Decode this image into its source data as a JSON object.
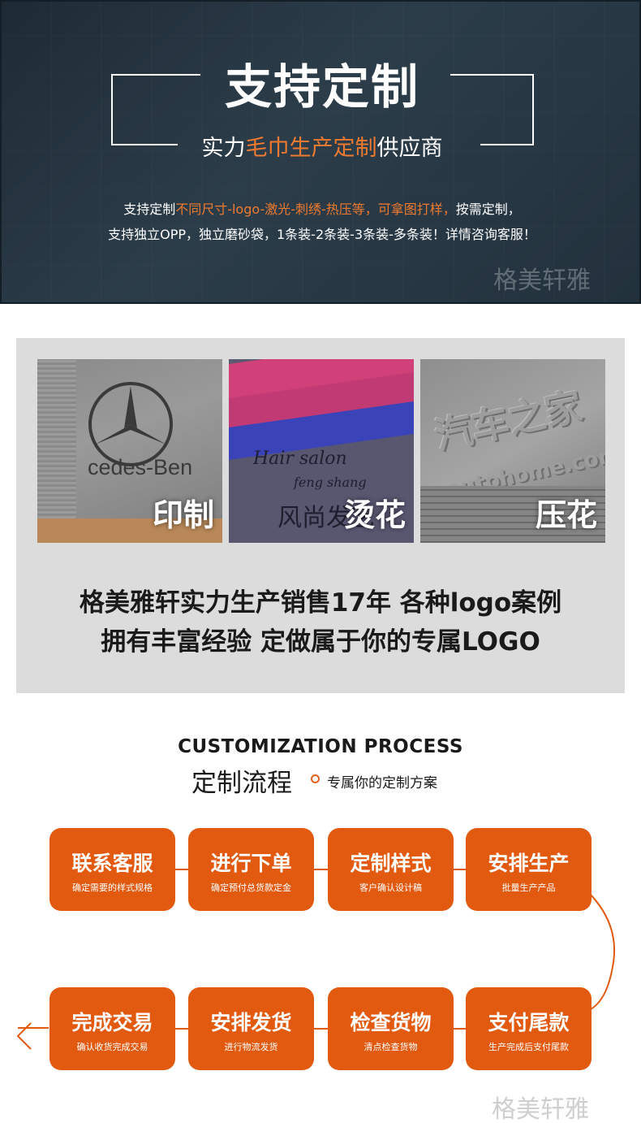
{
  "hero": {
    "title": "支持定制",
    "subtitle_pre": "实力",
    "subtitle_hl": "毛巾生产定制",
    "subtitle_post": "供应商",
    "line1_pre": "支持定制",
    "line1_hl": "不同尺寸-logo-激光-刺绣-热压等，可拿图打样，",
    "line1_post": "按需定制，",
    "line2": "支持独立OPP，独立磨砂袋，1条装-2条装-3条装-多条装！详情咨询客服！",
    "watermark": "格美轩雅"
  },
  "gallery": {
    "photos": [
      {
        "caption": "印制",
        "print": "cedes-Ben"
      },
      {
        "caption": "烫花",
        "print1": "Hair salon",
        "print2": "feng shang",
        "print3": "风尚发艺"
      },
      {
        "caption": "压花",
        "print1": "汽车之家",
        "print2": "autohome.com.cn"
      }
    ],
    "text1": "格美雅轩实力生产销售17年 各种logo案例",
    "text2": "拥有丰富经验  定做属于你的专属LOGO"
  },
  "process": {
    "title_en": "CUSTOMIZATION PROCESS",
    "title_cn": "定制流程",
    "note": "专属你的定制方案",
    "steps": [
      {
        "title": "联系客服",
        "desc": "确定需要的样式规格"
      },
      {
        "title": "进行下单",
        "desc": "确定预付总货款定金"
      },
      {
        "title": "定制样式",
        "desc": "客户确认设计稿"
      },
      {
        "title": "安排生产",
        "desc": "批量生产产品"
      },
      {
        "title": "支付尾款",
        "desc": "生产完成后支付尾款"
      },
      {
        "title": "检查货物",
        "desc": "清点检查货物"
      },
      {
        "title": "安排发货",
        "desc": "进行物流发货"
      },
      {
        "title": "完成交易",
        "desc": "确认收货完成交易"
      }
    ],
    "watermark": "格美轩雅"
  },
  "colors": {
    "accent": "#e25a10",
    "highlight": "#f07a2f",
    "hero_bg": "#26353f"
  }
}
